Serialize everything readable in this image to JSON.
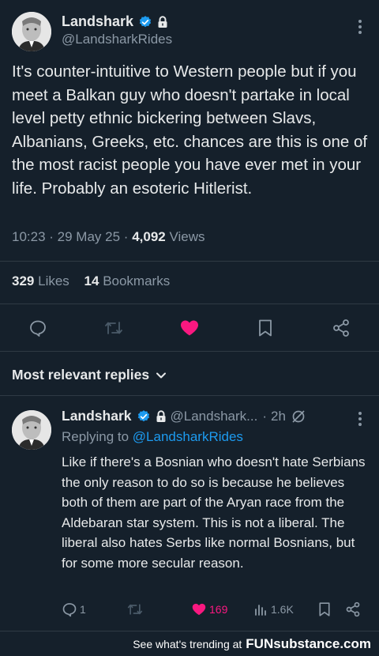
{
  "post": {
    "author_name": "Landshark",
    "author_handle": "@LandsharkRides",
    "text": "It's counter-intuitive to Western people but if you meet a Balkan guy who doesn't partake in local level petty ethnic bickering between Slavs, Albanians, Greeks, etc. chances are this is one of the most racist people you have ever met in your life. Probably an esoteric Hitlerist.",
    "time": "10:23",
    "date": "29 May 25",
    "views_count": "4,092",
    "views_label": "Views",
    "likes_count": "329",
    "likes_label": "Likes",
    "bookmarks_count": "14",
    "bookmarks_label": "Bookmarks"
  },
  "replies_header": "Most relevant replies",
  "reply": {
    "author_name": "Landshark",
    "author_handle": "@Landshark...",
    "age": "2h",
    "replying_prefix": "Replying to",
    "replying_to": "@LandsharkRides",
    "text": "Like if there's a Bosnian who doesn't hate Serbians the only reason to do so is because he believes both of them are part of the Aryan race from the Aldebaran star system. This is not a liberal. The liberal also hates Serbs like normal Bosnians, but for some more secular reason.",
    "reply_count": "1",
    "like_count": "169",
    "view_count": "1.6K"
  },
  "watermark": {
    "text": "See what's trending at",
    "brand": "FUNsubstance.com"
  },
  "colors": {
    "background": "#15202b",
    "accent_blue": "#1d9bf0",
    "like_pink": "#f91880",
    "muted": "#8b98a5"
  },
  "icons": [
    "verified-badge-icon",
    "lock-icon",
    "more-icon",
    "reply-icon",
    "retweet-icon",
    "heart-icon",
    "bookmark-icon",
    "share-icon",
    "chevron-down-icon",
    "grok-icon",
    "views-icon"
  ]
}
